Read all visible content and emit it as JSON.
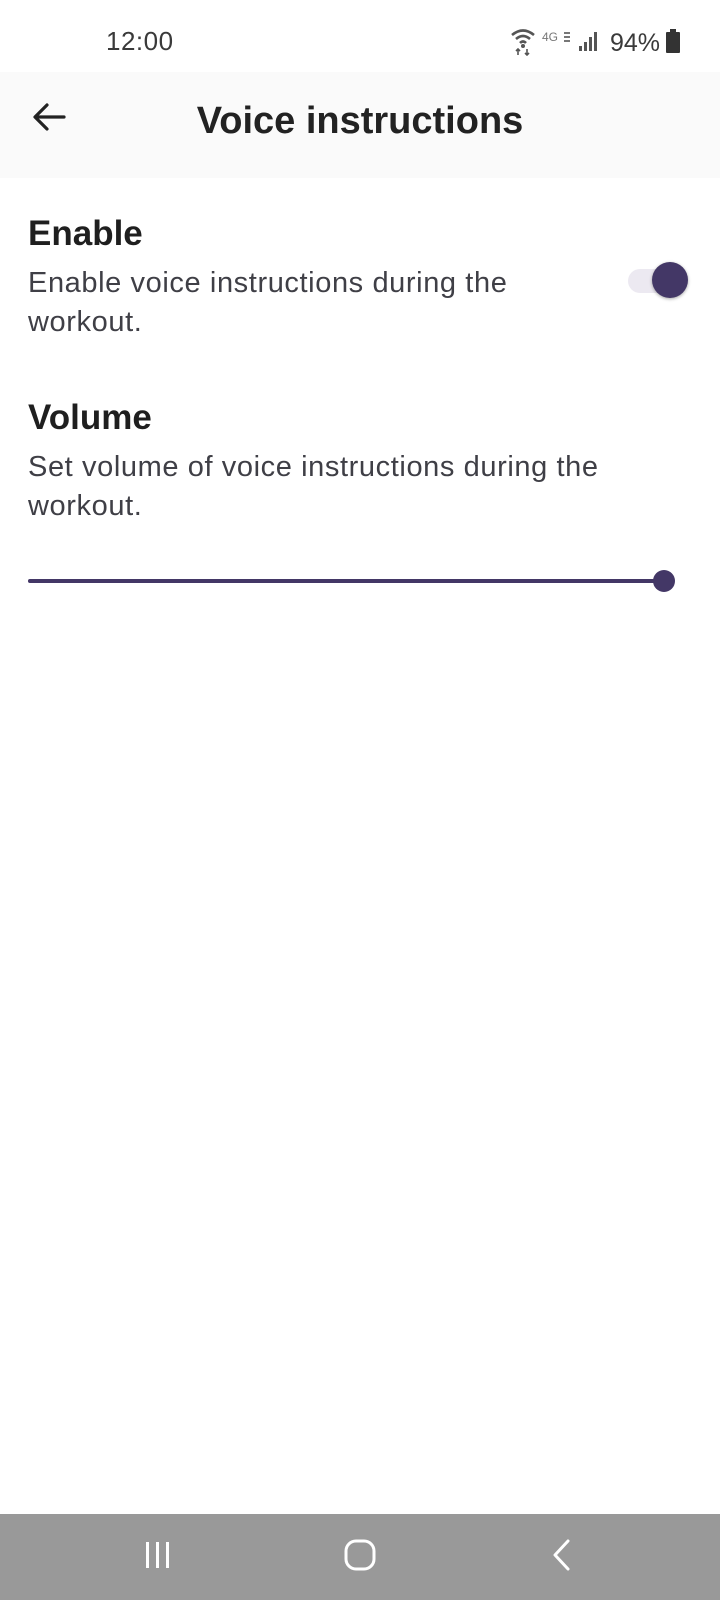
{
  "status_bar": {
    "time": "12:00",
    "network_label": "4G",
    "battery": "94%"
  },
  "app_bar": {
    "title": "Voice instructions",
    "back_icon": "arrow-left-icon"
  },
  "settings": {
    "enable": {
      "title": "Enable",
      "description": "Enable voice instructions during the workout.",
      "enabled": true
    },
    "volume": {
      "title": "Volume",
      "description": "Set volume of voice instructions during the workout.",
      "level_percent": 100
    }
  },
  "nav_bar": {
    "recents_icon": "recents-icon",
    "home_icon": "home-icon",
    "back_icon": "chevron-left-icon"
  },
  "colors": {
    "accent": "#433766",
    "toggle_track": "#ece9f1",
    "nav_bar": "#999999",
    "app_bar_bg": "#fafafa"
  }
}
